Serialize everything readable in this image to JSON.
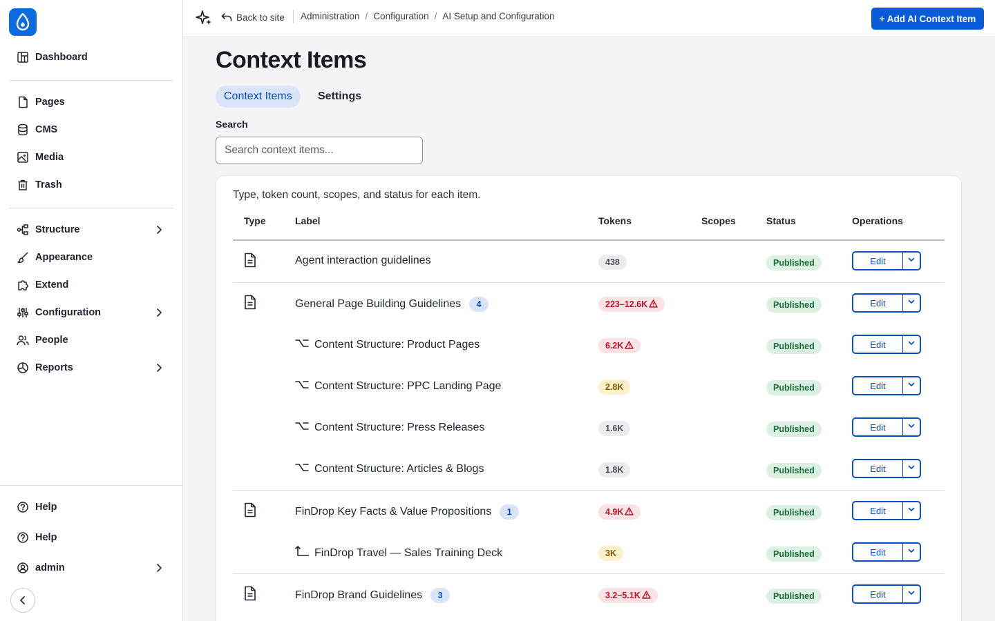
{
  "topbar": {
    "back_label": "Back to site",
    "breadcrumbs": [
      "Administration",
      "Configuration",
      "AI Setup and Configuration"
    ],
    "add_button_label": "+ Add AI Context Item"
  },
  "sidebar": {
    "group1": [
      {
        "label": "Dashboard",
        "icon": "dashboard-icon"
      }
    ],
    "group2": [
      {
        "label": "Pages",
        "icon": "page-icon"
      },
      {
        "label": "CMS",
        "icon": "database-icon"
      },
      {
        "label": "Media",
        "icon": "image-icon"
      },
      {
        "label": "Trash",
        "icon": "trash-icon"
      }
    ],
    "group3": [
      {
        "label": "Structure",
        "icon": "structure-icon",
        "expandable": true
      },
      {
        "label": "Appearance",
        "icon": "brush-icon",
        "expandable": false
      },
      {
        "label": "Extend",
        "icon": "puzzle-icon",
        "expandable": false
      },
      {
        "label": "Configuration",
        "icon": "sliders-icon",
        "expandable": true
      },
      {
        "label": "People",
        "icon": "people-icon",
        "expandable": false
      },
      {
        "label": "Reports",
        "icon": "chart-pie-icon",
        "expandable": true
      }
    ],
    "footer": [
      {
        "label": "Help",
        "icon": "help-icon"
      },
      {
        "label": "Help",
        "icon": "help-icon"
      },
      {
        "label": "admin",
        "icon": "user-icon",
        "expandable": true
      }
    ]
  },
  "page": {
    "title": "Context Items",
    "tabs": [
      "Context Items",
      "Settings"
    ],
    "active_tab": "Context Items",
    "search_label": "Search",
    "search_placeholder": "Search context items...",
    "search_value": ""
  },
  "table": {
    "caption": "Type, token count, scopes, and status for each item.",
    "headers": [
      "Type",
      "Label",
      "Tokens",
      "Scopes",
      "Status",
      "Operations"
    ],
    "edit_label": "Edit",
    "rows": [
      {
        "kind": "parent",
        "label": "Agent interaction guidelines",
        "count": "",
        "tokens": "438",
        "token_color": "gray",
        "warning": false,
        "scopes": "",
        "status": "Published"
      },
      {
        "kind": "parent",
        "label": "General Page Building Guidelines",
        "count": "4",
        "tokens": "223–12.6K",
        "token_color": "red",
        "warning": true,
        "scopes": "",
        "status": "Published"
      },
      {
        "kind": "child",
        "child_icon": "option-icon",
        "label": "Content Structure: Product Pages",
        "count": "",
        "tokens": "6.2K",
        "token_color": "red",
        "warning": true,
        "scopes": "",
        "status": "Published"
      },
      {
        "kind": "child",
        "child_icon": "option-icon",
        "label": "Content Structure: PPC Landing Page",
        "count": "",
        "tokens": "2.8K",
        "token_color": "yellow",
        "warning": false,
        "scopes": "",
        "status": "Published"
      },
      {
        "kind": "child",
        "child_icon": "option-icon",
        "label": "Content Structure: Press Releases",
        "count": "",
        "tokens": "1.6K",
        "token_color": "gray",
        "warning": false,
        "scopes": "",
        "status": "Published"
      },
      {
        "kind": "child",
        "child_icon": "option-icon",
        "label": "Content Structure: Articles & Blogs",
        "count": "",
        "tokens": "1.8K",
        "token_color": "gray",
        "warning": false,
        "scopes": "",
        "status": "Published"
      },
      {
        "kind": "parent",
        "label": "FinDrop Key Facts & Value Propositions",
        "count": "1",
        "tokens": "4.9K",
        "token_color": "red",
        "warning": true,
        "scopes": "",
        "status": "Published"
      },
      {
        "kind": "child",
        "child_icon": "corner-up-icon",
        "label": "FinDrop Travel — Sales Training Deck",
        "count": "",
        "tokens": "3K",
        "token_color": "yellow",
        "warning": false,
        "scopes": "",
        "status": "Published"
      },
      {
        "kind": "parent",
        "label": "FinDrop Brand Guidelines",
        "count": "3",
        "tokens": "3.2–5.1K",
        "token_color": "red",
        "warning": true,
        "scopes": "",
        "status": "Published"
      }
    ]
  },
  "colors": {
    "primary": "#0a5bd8",
    "accent_badge_bg": "#d9e4f9",
    "published_bg": "#dcefe3",
    "warning_red": "#b3132b"
  }
}
